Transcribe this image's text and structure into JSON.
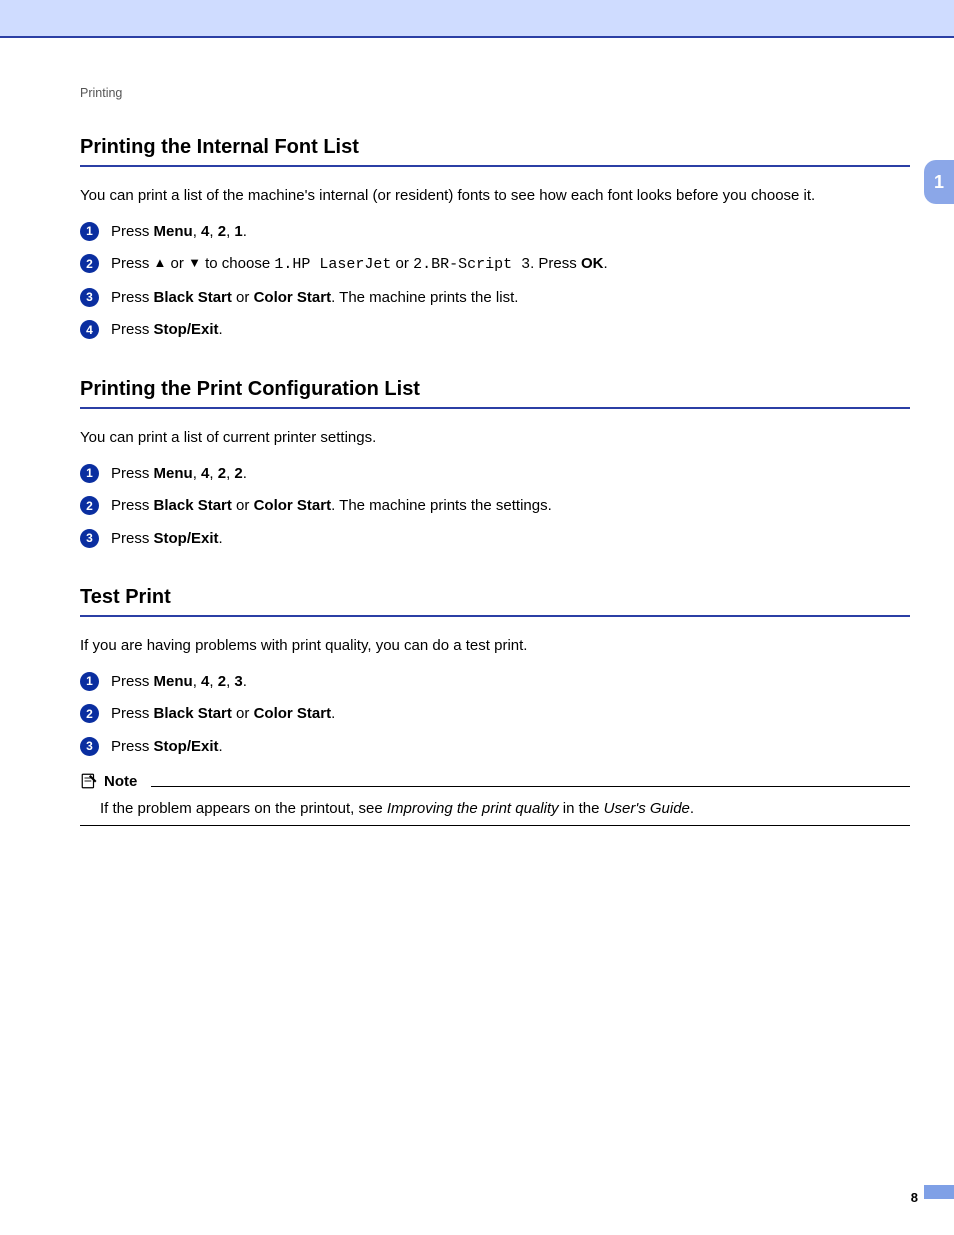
{
  "header": {
    "breadcrumb": "Printing"
  },
  "sidetab": {
    "chapter": "1"
  },
  "sections": {
    "fontlist": {
      "title": "Printing the Internal Font List",
      "lead": "You can print a list of the machine's internal (or resident) fonts to see how each font looks before you choose it.",
      "step1_pre": "Press ",
      "step1_b1": "Menu",
      "step1_c1": ", ",
      "step1_b2": "4",
      "step1_c2": ", ",
      "step1_b3": "2",
      "step1_c3": ", ",
      "step1_b4": "1",
      "step1_c4": ".",
      "step2_pre": "Press ",
      "step2_up": "▲",
      "step2_mid1": " or ",
      "step2_down": "▼",
      "step2_mid2": " to choose ",
      "step2_m1": "1.HP LaserJet",
      "step2_or": " or ",
      "step2_m2": "2.BR-Script 3",
      "step2_post1": ". Press ",
      "step2_ok": "OK",
      "step2_post2": ".",
      "step3_pre": "Press ",
      "step3_b1": "Black Start",
      "step3_or": " or ",
      "step3_b2": "Color Start",
      "step3_post": ". The machine prints the list.",
      "step4_pre": "Press ",
      "step4_b1": "Stop/Exit",
      "step4_post": "."
    },
    "config": {
      "title": "Printing the Print Configuration List",
      "lead": "You can print a list of current printer settings.",
      "step1_pre": "Press ",
      "step1_b1": "Menu",
      "step1_c1": ", ",
      "step1_b2": "4",
      "step1_c2": ", ",
      "step1_b3": "2",
      "step1_c3": ", ",
      "step1_b4": "2",
      "step1_c4": ".",
      "step2_pre": "Press ",
      "step2_b1": "Black Start",
      "step2_or": " or ",
      "step2_b2": "Color Start",
      "step2_post": ". The machine prints the settings.",
      "step3_pre": "Press ",
      "step3_b1": "Stop/Exit",
      "step3_post": "."
    },
    "test": {
      "title": "Test Print",
      "lead": "If you are having problems with print quality, you can do a test print.",
      "step1_pre": "Press ",
      "step1_b1": "Menu",
      "step1_c1": ", ",
      "step1_b2": "4",
      "step1_c2": ", ",
      "step1_b3": "2",
      "step1_c3": ", ",
      "step1_b4": "3",
      "step1_c4": ".",
      "step2_pre": "Press ",
      "step2_b1": "Black Start",
      "step2_or": " or ",
      "step2_b2": "Color Start",
      "step2_post": ".",
      "step3_pre": "Press ",
      "step3_b1": "Stop/Exit",
      "step3_post": ".",
      "note_label": "Note",
      "note_t1": "If the problem appears on the printout, see ",
      "note_i1": "Improving the print quality",
      "note_t2": " in the ",
      "note_i2": "User's Guide",
      "note_t3": "."
    }
  },
  "footer": {
    "page": "8"
  }
}
